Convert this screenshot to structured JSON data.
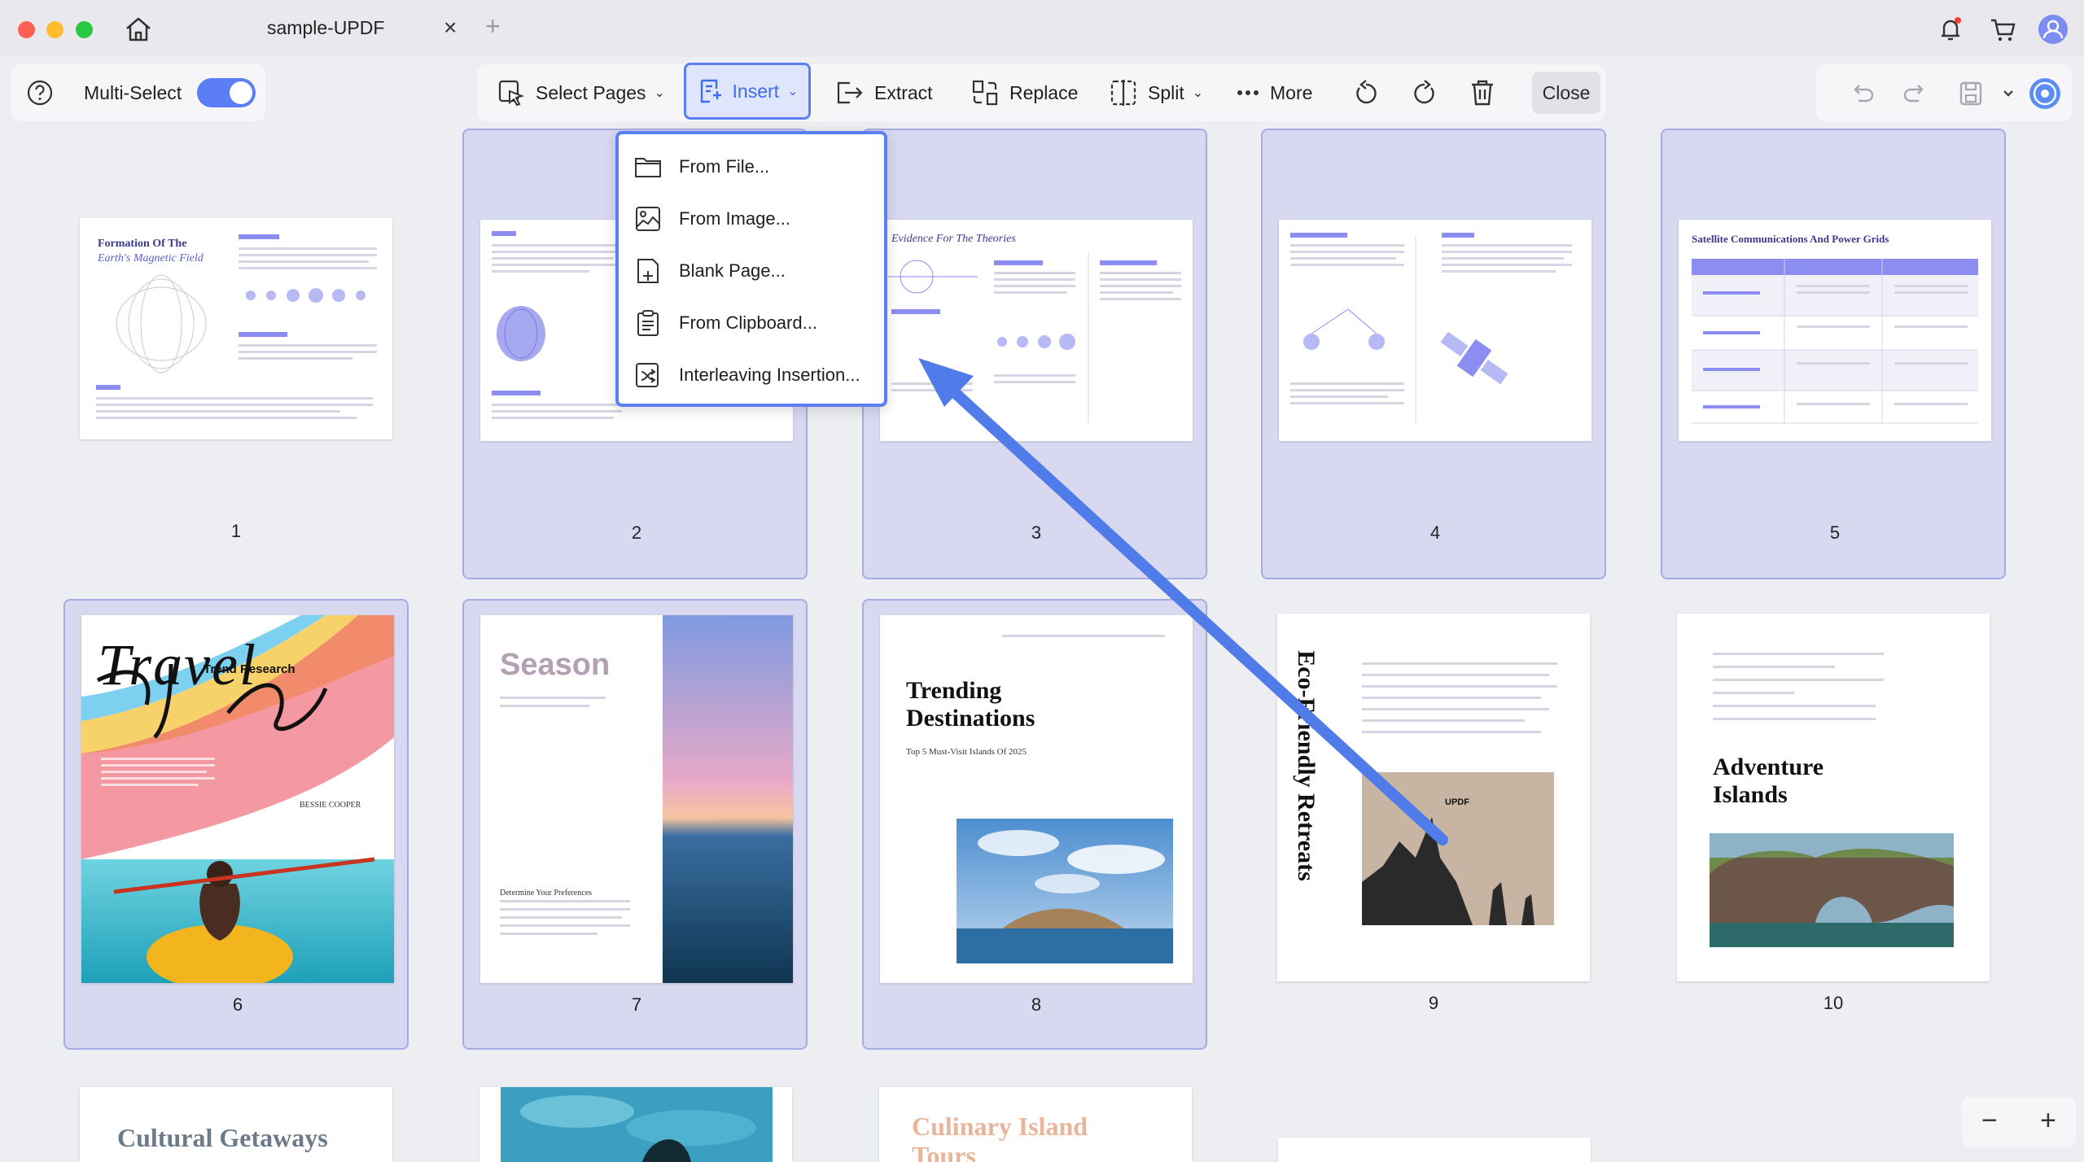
{
  "window": {
    "tab_title": "sample-UPDF",
    "tab_close": "×",
    "tab_add": "+"
  },
  "multiselect": {
    "label": "Multi-Select",
    "enabled": true
  },
  "toolbar": {
    "select_pages": "Select Pages",
    "insert": "Insert",
    "extract": "Extract",
    "replace": "Replace",
    "split": "Split",
    "more": "More",
    "close": "Close",
    "caret": "⌄"
  },
  "insert_menu": {
    "items": [
      {
        "label": "From File...",
        "icon": "folder-icon"
      },
      {
        "label": "From Image...",
        "icon": "image-icon"
      },
      {
        "label": "Blank Page...",
        "icon": "blank-page-icon"
      },
      {
        "label": "From Clipboard...",
        "icon": "clipboard-icon"
      },
      {
        "label": "Interleaving Insertion...",
        "icon": "interleave-icon"
      }
    ]
  },
  "pages": [
    {
      "number": "1",
      "selected": false,
      "title": "Formation Of The",
      "subtitle": "Earth's Magnetic Field"
    },
    {
      "number": "2",
      "selected": true
    },
    {
      "number": "3",
      "selected": true,
      "title": "Evidence For The Theories"
    },
    {
      "number": "4",
      "selected": true
    },
    {
      "number": "5",
      "selected": true,
      "title": "Satellite Communications And Power Grids"
    },
    {
      "number": "6",
      "selected": true,
      "title": "Travel",
      "subtitle": "Trend Research",
      "author": "BESSIE COOPER"
    },
    {
      "number": "7",
      "selected": true,
      "title": "Season",
      "subtitle": "Determine Your Preferences"
    },
    {
      "number": "8",
      "selected": true,
      "title": "Trending Destinations",
      "subtitle": "Top 5 Must-Visit Islands Of 2025"
    },
    {
      "number": "9",
      "selected": false,
      "title": "Eco-Friendly Retreats",
      "badge": "UPDF"
    },
    {
      "number": "10",
      "selected": false,
      "title": "Adventure Islands"
    }
  ],
  "partial_pages": [
    {
      "title": "Cultural Getaways"
    },
    {
      "title": ""
    },
    {
      "title": "Culinary Island Tours"
    },
    {
      "title": ""
    }
  ],
  "zoom": {
    "minus": "−",
    "plus": "+"
  },
  "colors": {
    "accent": "#5b7ef5",
    "selected_card": "#d8d9f1",
    "arrow": "#4f7ce8"
  }
}
